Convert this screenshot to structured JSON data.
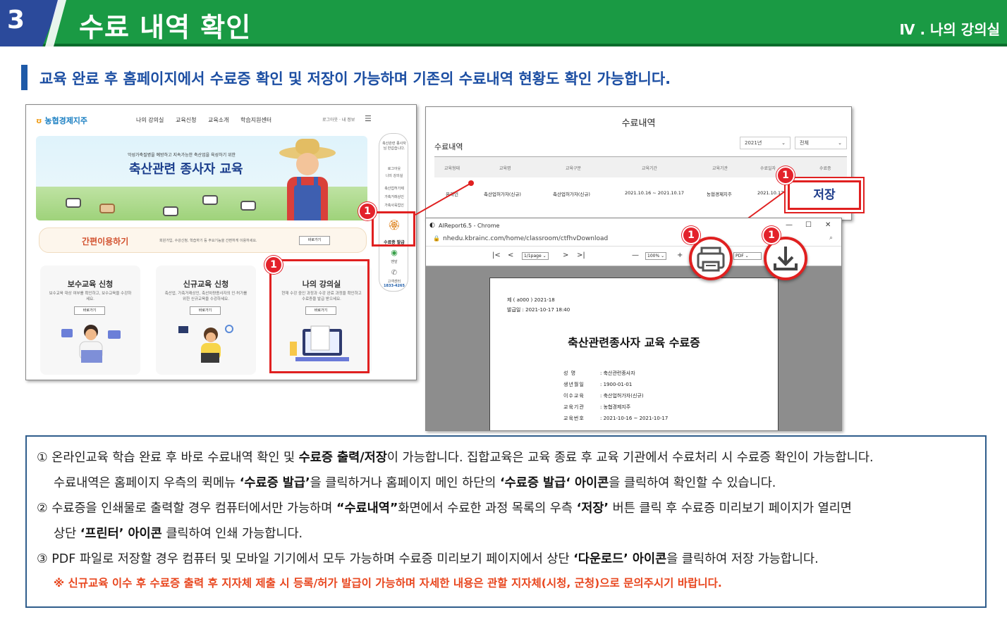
{
  "header": {
    "number": "3",
    "title": "수료 내역 확인",
    "section": "Ⅳ . 나의 강의실",
    "color_green": "#1a9a44",
    "color_blue": "#2b4a9b"
  },
  "subtitle": "교육 완료 후 홈페이지에서 수료증 확인 및 저장이 가능하며 기존의 수료내역 현황도 확인 가능합니다.",
  "site": {
    "logo": "농협경제지주",
    "nav": [
      "나의 강의실",
      "교육신청",
      "교육소개",
      "학습지원센터"
    ],
    "login": "로그아웃 · 내 정보",
    "banner_sub": "악성가축질병을 예방하고 지속가능한 축산업을 육성하기 위한",
    "banner_title": "축산관련 종사자 교육",
    "quick_menu": [
      "축산관련 종사자님 반갑습니다.",
      "로그아웃",
      "나의 강의실",
      "축산업허가제",
      "가축거래상인",
      "가축사육업인",
      "수료증 발급",
      "맨앞",
      "고객센터",
      "1833-4265"
    ],
    "ez_title": "간편이용하기",
    "ez_desc": "회원가입, 수강신청, 학습하기 등 주요기능을 간편하게 이용하세요.",
    "ez_btn": "바로가기",
    "cards": [
      {
        "title": "보수교육 신청",
        "desc": "보수교육 대상 여부를 확인하고, 보수교육을 수강하세요.",
        "btn": "바로가기"
      },
      {
        "title": "신규교육 신청",
        "desc": "축산업, 가축거래상인, 축산차량종사자의 인·허가를 위한 신규교육을 수강하세요.",
        "btn": "바로가기"
      },
      {
        "title": "나의 강의실",
        "desc": "현재 수강 중인 과정과 수강 완료 과정을 확인하고 수료증을 발급 받으세요.",
        "btn": "바로가기"
      }
    ]
  },
  "history": {
    "title": "수료내역",
    "label": "수료내역",
    "year": "2021년",
    "filter": "전체",
    "headers": [
      "교육형태",
      "교육명",
      "교육구분",
      "교육기간",
      "교육기관",
      "수료일자",
      "수료증"
    ],
    "row": [
      "온라인",
      "축산업허가자(신규)",
      "축산업허가자(신규)",
      "2021.10.16 ~ 2021.10.17",
      "농협경제지주",
      "2021.10.17"
    ],
    "save": "저장"
  },
  "viewer": {
    "window_title": "AIReport6.5 - Chrome",
    "url": "nhedu.kbrainc.com/home/classroom/ctfhvDownload",
    "page_select": "1/1page",
    "zoom": "100%",
    "format": "PDF",
    "doc_no": "제 ( a000 ) 2021-18",
    "issued": "발급일 :  2021-10-17 18:40",
    "doc_title": "축산관련종사자 교육 수료증",
    "fields": [
      {
        "k": "성    명",
        "v": "축산관련종사자"
      },
      {
        "k": "생년월일",
        "v": "1900-01-01"
      },
      {
        "k": "이수교육",
        "v": "축산업허가자(신규)"
      },
      {
        "k": "교육기관",
        "v": "농협경제지주"
      },
      {
        "k": "교육번호",
        "v": "2021-10-16 ~ 2021-10-17"
      }
    ]
  },
  "badge": "1",
  "info": {
    "l1_a": "① 온라인교육 학습 완료 후 바로 수료내역 확인 및 ",
    "l1_b": "수료증 출력/저장",
    "l1_c": "이 가능합니다. 집합교육은 교육 종료 후 교육 기관에서 수료처리 시 수료증 확인이 가능합니다.",
    "l2_a": "수료내역은 홈페이지 우측의 퀵메뉴 ",
    "l2_b": "‘수료증 발급’",
    "l2_c": "을 클릭하거나 홈페이지 메인 하단의 ",
    "l2_d": "‘수료증 발급‘ 아이콘",
    "l2_e": "을 클릭하여 확인할 수 있습니다.",
    "l3_a": "② 수료증을 인쇄물로 출력할 경우 컴퓨터에서만 가능하며 ",
    "l3_b": "“수료내역”",
    "l3_c": "화면에서 수료한 과정 목록의 우측 ",
    "l3_d": "‘저장’",
    "l3_e": " 버튼 클릭 후 수료증 미리보기 페이지가 열리면",
    "l4_a": "상단 ",
    "l4_b": "‘프린터’ 아이콘",
    "l4_c": " 클릭하여 인쇄 가능합니다.",
    "l5_a": "③ PDF 파일로 저장할 경우 컴퓨터 및 모바일 기기에서 모두 가능하며 수료증 미리보기 페이지에서 상단 ",
    "l5_b": "‘다운로드’ 아이콘",
    "l5_c": "을 클릭하여 저장 가능합니다.",
    "note": "※ 신규교육 이수 후 수료증 출력 후 지자체 제출 시 등록/허가 발급이 가능하며 자세한 내용은 관할 지자체(시청, 군청)으로 문의주시기 바랍니다.",
    "note_color": "#e8461e"
  }
}
